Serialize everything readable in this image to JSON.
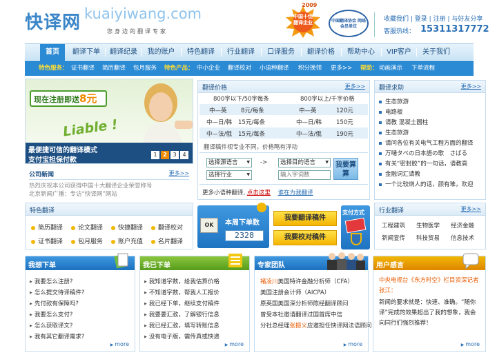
{
  "header": {
    "logo_cn": "快译网",
    "logo_en": "kuaiyiwang.com",
    "slogan": "您身边的翻译专家",
    "badge_year": "2009",
    "badge_text": "中国十佳翻译企业",
    "seal_text": "中国翻译协会 网络会员单位",
    "top_links": [
      "收藏我们",
      "登录",
      "注册",
      "与好友分享"
    ],
    "hotline_label": "客服热线：",
    "hotline": "15311317772"
  },
  "nav": {
    "items": [
      "首页",
      "翻译下单",
      "翻译纪录",
      "我的账户",
      "特色翻译",
      "行业翻译",
      "口译服务",
      "翻译价格",
      "帮助中心",
      "VIP客户",
      "关于我们"
    ]
  },
  "subnav": {
    "service_label": "特色服务：",
    "service": [
      "证书翻译",
      "简历翻译",
      "包月服务"
    ],
    "product_label": "特色产品：",
    "product": [
      "中小企业",
      "翻译校对",
      "小语种翻译",
      "积分换领",
      "更多>>"
    ],
    "help_label": "帮助：",
    "help": [
      "动画演示",
      "下单流程"
    ]
  },
  "banner": {
    "promo": "现在注册即送",
    "promo_num": "8元",
    "liable": "Liable !",
    "tagline1": "最便捷可信的翻译模式",
    "tagline2": "支付宝担保付款",
    "pages": [
      "1",
      "2",
      "3",
      "4"
    ],
    "active_page": "2"
  },
  "news": {
    "title": "公司新闻",
    "more": "更多>>",
    "items": [
      "热烈庆祝本公司获得中国十大翻译企业荣誉称号",
      "北京新闻广播：专访“快译网”网站"
    ]
  },
  "price": {
    "title": "翻译价格",
    "more": "更多>>",
    "head": [
      "800字以下/50字每条",
      "800字以上/千字价格"
    ],
    "rows": [
      [
        "中—英",
        "8元/每条",
        "中—英",
        "120元"
      ],
      [
        "中—日/韩",
        "15元/每条",
        "中—日/韩",
        "150元"
      ],
      [
        "中—法/俄",
        "15元/每条",
        "中—法/俄",
        "190元"
      ]
    ],
    "note": "翻译稿件视专业不同，价格略有浮动",
    "src_lang": "选择源语言",
    "arrow": "->",
    "dst_lang": "选择目的语言",
    "industry": "选择行业",
    "word_placeholder": "输入字词数",
    "calc": "我要算算",
    "bottom_text": "更多小语种翻译,",
    "bottom_link1": "点击这里",
    "bottom_link2": "谁在为我翻译"
  },
  "help": {
    "title": "翻译求助",
    "more": "更多>>",
    "items": [
      "生态旅游",
      "电路板",
      "请教 混凝土圆柱",
      "生态旅游",
      "请问各位有关电气工程方面的翻译",
      "万嗵タベの日本語の歌　さばる",
      "有关“密封胶”的一句话，请教高",
      "金融词汇请教",
      "一个比较烧人的话，颜有难，欢迎"
    ]
  },
  "feature": {
    "title": "特色翻译",
    "items": [
      "简历翻译",
      "论文翻译",
      "快捷翻译",
      "翻译校对",
      "证书翻译",
      "包月服务",
      "账户充值",
      "名片翻译"
    ]
  },
  "weekly": {
    "title": "本周下单数",
    "count": "2328",
    "order_btn": "我要翻译稿件",
    "proof_btn": "我要校对稿件",
    "pay_title": "支付方式"
  },
  "industry": {
    "title": "行业翻译",
    "more": "更多>>",
    "items": [
      "工程建筑",
      "生物医学",
      "经济金融",
      "新闻宣传",
      "科技贸易",
      "信息技术"
    ]
  },
  "col_order": {
    "title": "我想下单",
    "items": [
      "我要怎么注册?",
      "怎么提交待译稿件?",
      "先付款有保障吗?",
      "我要怎么支付?",
      "怎么获取译文?",
      "我有其它翻译需求?"
    ],
    "more": "more"
  },
  "col_placed": {
    "title": "我已下单",
    "items": [
      "我知道字数，给我估算价格",
      "不知道字数，帮我人工报价",
      "我已经下单，继续支付稿件",
      "我要要汇款，了解银行信息",
      "我已经汇款，填写转账信息",
      "没有电子版，需传真或快递"
    ],
    "more": "more"
  },
  "col_team": {
    "title": "专家团队",
    "name": "褚凌川",
    "items": [
      "美国特许金融分析师（CFA）",
      "美国注册会计师（AICPA）",
      "原英国美国深分析师陈经翻译顾问",
      "曾受本社邀请翻译过国首席中信",
      "分社总经理",
      "张振义",
      "应邀担任快译网法语顾问"
    ],
    "more": "more"
  },
  "col_testimonial": {
    "title": "用户感言",
    "source": "中央电视台《东方时空》栏目资深记者张江：",
    "quote": "新闻的要求就是：快速、准确。“随你译”完成的效果超出了我的想象，我会向同行们强烈推荐！",
    "more": "more"
  }
}
